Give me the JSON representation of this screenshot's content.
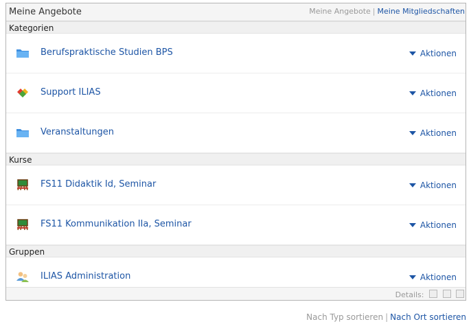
{
  "header": {
    "title": "Meine Angebote",
    "link_current": "Meine Angebote",
    "separator": "|",
    "link_memberships": "Meine Mitgliedschaften"
  },
  "sections": [
    {
      "label": "Kategorien",
      "items": [
        {
          "icon": "folder-icon",
          "title": "Berufspraktische Studien BPS",
          "action": "Aktionen"
        },
        {
          "icon": "support-icon",
          "title": "Support ILIAS",
          "action": "Aktionen"
        },
        {
          "icon": "folder-icon",
          "title": "Veranstaltungen",
          "action": "Aktionen"
        }
      ]
    },
    {
      "label": "Kurse",
      "items": [
        {
          "icon": "course-board-icon",
          "title": "FS11 Didaktik Id, Seminar",
          "action": "Aktionen"
        },
        {
          "icon": "course-board-icon",
          "title": "FS11 Kommunikation IIa, Seminar",
          "action": "Aktionen"
        }
      ]
    },
    {
      "label": "Gruppen",
      "items": [
        {
          "icon": "group-people-icon",
          "title": "ILIAS Administration",
          "action": "Aktionen"
        }
      ]
    }
  ],
  "footer": {
    "details_label": "Details:",
    "sort_by_type": "Nach Typ sortieren",
    "separator": "|",
    "sort_by_location": "Nach Ort sortieren"
  },
  "colors": {
    "link": "#1d55a5",
    "muted": "#999999",
    "header_bg": "#f5f5f5"
  }
}
